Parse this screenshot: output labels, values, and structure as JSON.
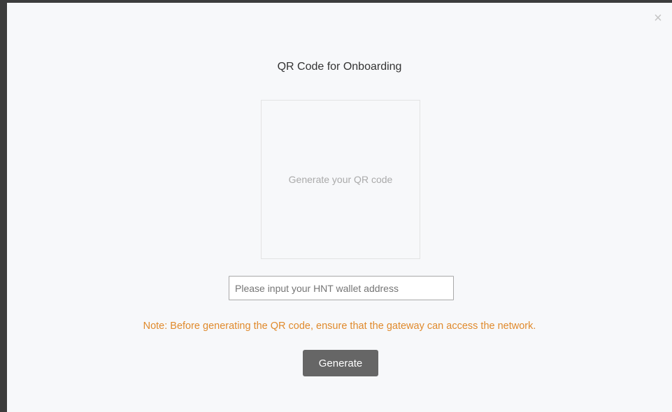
{
  "modal": {
    "close_glyph": "×",
    "title": "QR Code for Onboarding",
    "qr_placeholder": "Generate your QR code",
    "wallet_input": {
      "value": "",
      "placeholder": "Please input your HNT wallet address"
    },
    "note": "Note: Before generating the QR code, ensure that the gateway can access the network.",
    "generate_label": "Generate"
  },
  "colors": {
    "note_text": "#e08a2c",
    "button_bg": "#666666",
    "modal_bg": "#f7f8fa"
  },
  "icons": {
    "close": "close-icon"
  }
}
